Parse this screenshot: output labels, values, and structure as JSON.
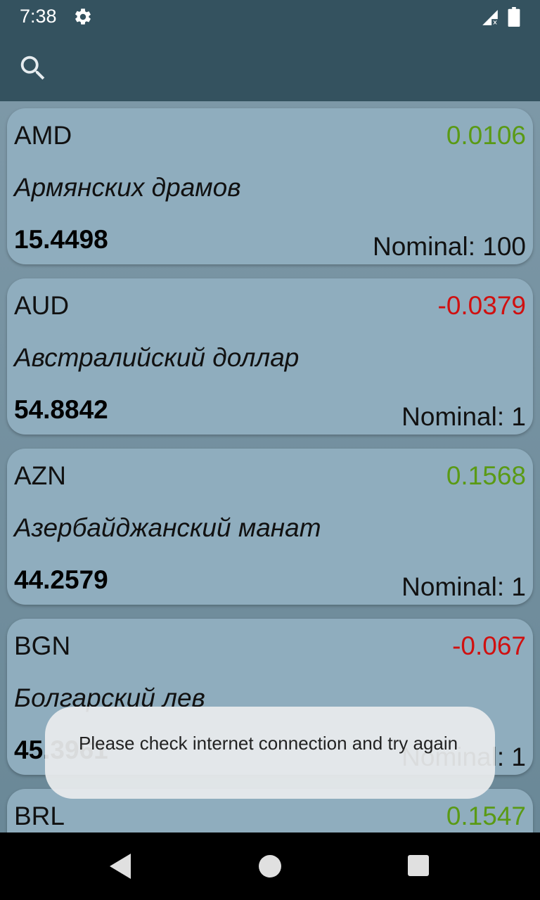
{
  "status_bar": {
    "time": "7:38",
    "icons": [
      "settings-gear-icon",
      "signal-no-data-icon",
      "battery-icon"
    ]
  },
  "toolbar": {
    "search_icon": "search-icon"
  },
  "currencies": [
    {
      "code": "AMD",
      "change": "0.0106",
      "change_color": "#5a9a15",
      "name": "Армянских драмов",
      "rate": "15.4498",
      "nominal": "Nominal: 100"
    },
    {
      "code": "AUD",
      "change": "-0.0379",
      "change_color": "#d01010",
      "name": "Австралийский доллар",
      "rate": "54.8842",
      "nominal": "Nominal: 1"
    },
    {
      "code": "AZN",
      "change": "0.1568",
      "change_color": "#5a9a15",
      "name": "Азербайджанский манат",
      "rate": "44.2579",
      "nominal": "Nominal: 1"
    },
    {
      "code": "BGN",
      "change": "-0.067",
      "change_color": "#d01010",
      "name": "Болгарский лев",
      "rate": "45.3961",
      "nominal": "Nominal: 1"
    },
    {
      "code": "BRL",
      "change": "0.1547",
      "change_color": "#5a9a15"
    }
  ],
  "toast": {
    "message": "Please check internet connection and try again"
  },
  "nav_bar": {
    "icons": [
      "back-icon",
      "home-icon",
      "recent-apps-icon"
    ]
  }
}
